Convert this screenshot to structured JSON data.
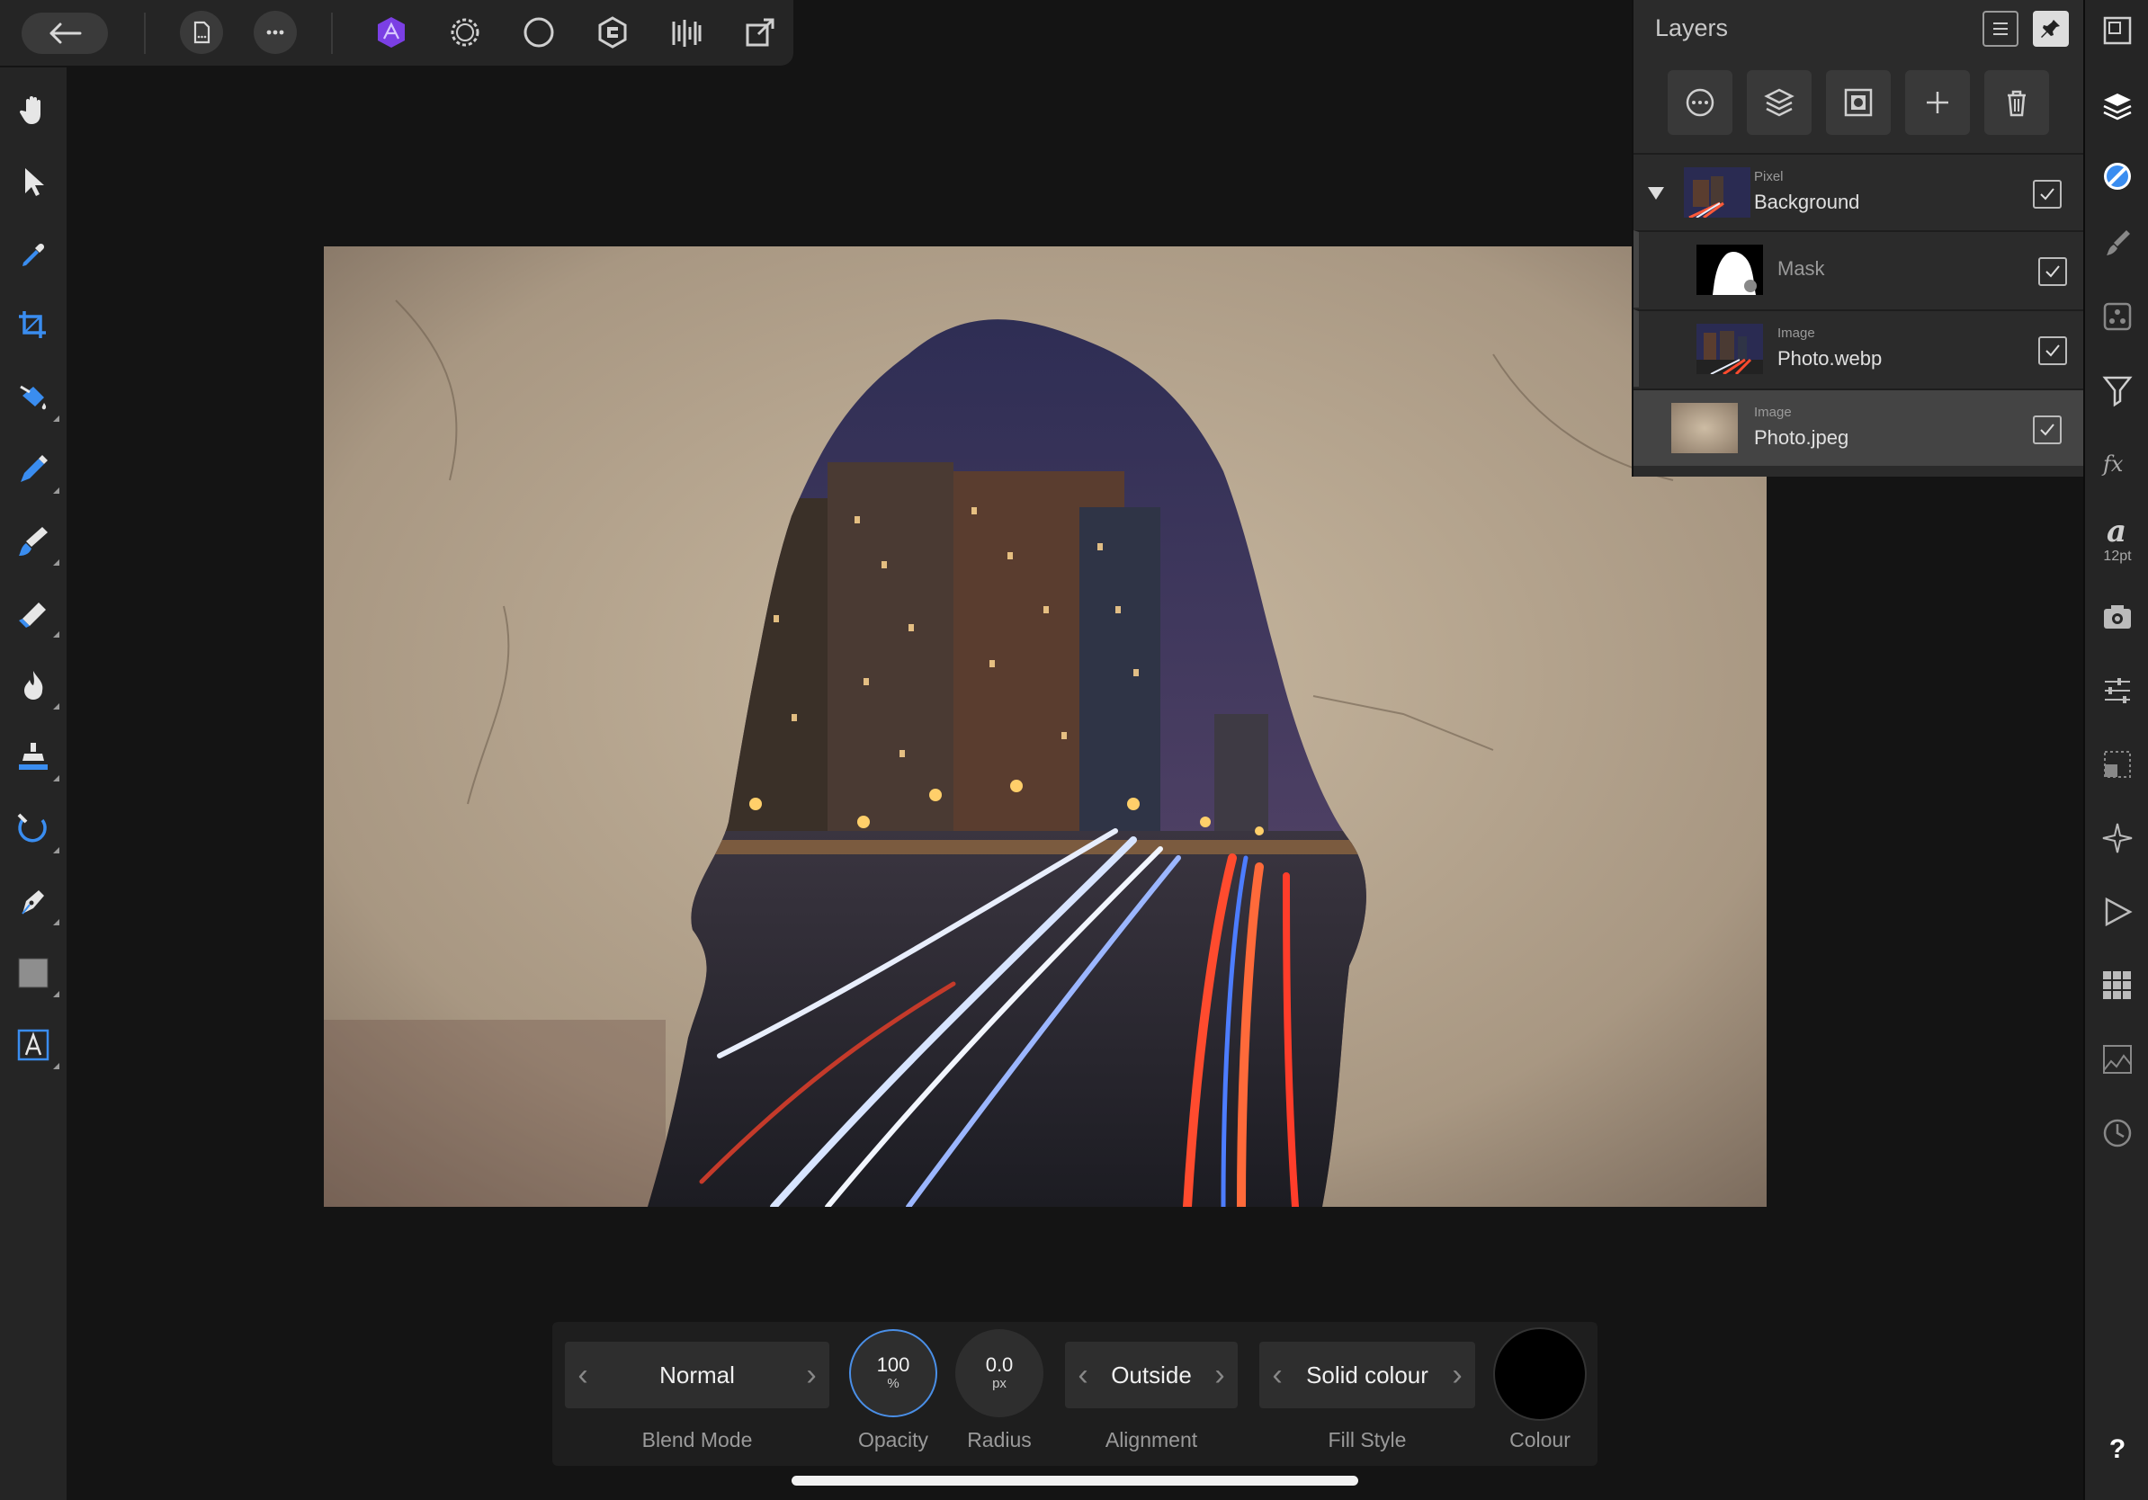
{
  "top_toolbar": {
    "back_icon": "back-arrow-icon",
    "document_icon": "document-icon",
    "more_icon": "more-icon",
    "personas": [
      "photo-persona-icon",
      "liquify-persona-icon",
      "develop-persona-icon",
      "tone-mapping-persona-icon",
      "export-persona-icon",
      "share-icon"
    ]
  },
  "left_tools": [
    "hand-icon",
    "move-icon",
    "color-picker-icon",
    "crop-icon",
    "flood-fill-icon",
    "selection-brush-icon",
    "paint-brush-icon",
    "erase-brush-icon",
    "burn-brush-icon",
    "clone-brush-icon",
    "healing-brush-icon",
    "pen-icon",
    "rectangle-shape-icon",
    "artistic-text-icon"
  ],
  "right_studios": [
    "navigator-icon",
    "layers-icon",
    "colour-icon",
    "brush-icon",
    "stock-icon",
    "adjustments-icon",
    "fx-icon",
    "text-styles-icon",
    "snapshots-icon",
    "channels-icon",
    "transform-icon",
    "assets-icon",
    "macro-icon",
    "swatches-icon",
    "histogram-icon",
    "history-icon",
    "help-icon"
  ],
  "right_font_size": "12pt",
  "help_label": "?",
  "layers_panel": {
    "title": "Layers",
    "actions": [
      "layer-options-icon",
      "blend-ranges-icon",
      "mask-icon",
      "add-layer-icon",
      "delete-layer-icon"
    ],
    "layers": [
      {
        "type": "Pixel",
        "name": "Background",
        "expanded": true,
        "visible": true
      },
      {
        "type": "",
        "name": "Mask",
        "visible": true
      },
      {
        "type": "Image",
        "name": "Photo.webp",
        "visible": true
      },
      {
        "type": "Image",
        "name": "Photo.jpeg",
        "visible": true,
        "selected": true
      }
    ]
  },
  "bottom_bar": {
    "blend_mode": {
      "value": "Normal",
      "label": "Blend Mode"
    },
    "opacity": {
      "value": "100",
      "unit": "%",
      "label": "Opacity"
    },
    "radius": {
      "value": "0.0",
      "unit": "px",
      "label": "Radius"
    },
    "alignment": {
      "value": "Outside",
      "label": "Alignment"
    },
    "fill_style": {
      "value": "Solid colour",
      "label": "Fill Style"
    },
    "colour": {
      "label": "Colour",
      "swatch": "#000000"
    }
  },
  "colors": {
    "accent": "#4a8fe7",
    "panel": "#2b2b2b",
    "toolbar": "#252525",
    "canvas_bg": "#141414"
  }
}
